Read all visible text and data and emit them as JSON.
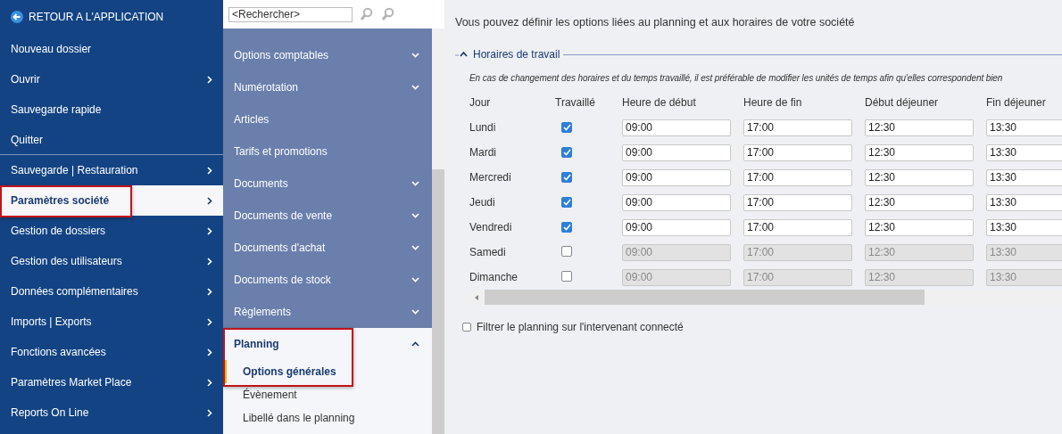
{
  "main_menu": {
    "back": "RETOUR A L'APPLICATION",
    "items": [
      {
        "label": "Nouveau dossier",
        "submenu": false,
        "selected": false,
        "highlighted": false,
        "divider_after": false
      },
      {
        "label": "Ouvrir",
        "submenu": true,
        "selected": false,
        "highlighted": false,
        "divider_after": false
      },
      {
        "label": "Sauvegarde rapide",
        "submenu": false,
        "selected": false,
        "highlighted": false,
        "divider_after": false
      },
      {
        "label": "Quitter",
        "submenu": false,
        "selected": false,
        "highlighted": false,
        "divider_after": true
      },
      {
        "label": "Sauvegarde | Restauration",
        "submenu": true,
        "selected": false,
        "highlighted": false,
        "divider_after": false
      },
      {
        "label": "Paramètres société",
        "submenu": true,
        "selected": true,
        "highlighted": true,
        "divider_after": false
      },
      {
        "label": "Gestion de dossiers",
        "submenu": true,
        "selected": false,
        "highlighted": false,
        "divider_after": false
      },
      {
        "label": "Gestion des utilisateurs",
        "submenu": true,
        "selected": false,
        "highlighted": false,
        "divider_after": false
      },
      {
        "label": "Données complémentaires",
        "submenu": true,
        "selected": false,
        "highlighted": false,
        "divider_after": false
      },
      {
        "label": "Imports | Exports",
        "submenu": true,
        "selected": false,
        "highlighted": false,
        "divider_after": false
      },
      {
        "label": "Fonctions avancées",
        "submenu": true,
        "selected": false,
        "highlighted": false,
        "divider_after": false
      },
      {
        "label": "Paramètres Market Place",
        "submenu": true,
        "selected": false,
        "highlighted": false,
        "divider_after": false
      },
      {
        "label": "Reports On Line",
        "submenu": true,
        "selected": false,
        "highlighted": false,
        "divider_after": false
      }
    ]
  },
  "settings_menu": {
    "search": {
      "placeholder": "<Rechercher>"
    },
    "items": [
      {
        "label": "Options comptables",
        "expanded": false,
        "expandable": true,
        "highlighted": false
      },
      {
        "label": "Numérotation",
        "expanded": false,
        "expandable": true,
        "highlighted": false
      },
      {
        "label": "Articles",
        "expanded": false,
        "expandable": false,
        "highlighted": false
      },
      {
        "label": "Tarifs et promotions",
        "expanded": false,
        "expandable": false,
        "highlighted": false
      },
      {
        "label": "Documents",
        "expanded": false,
        "expandable": true,
        "highlighted": false
      },
      {
        "label": "Documents de vente",
        "expanded": false,
        "expandable": true,
        "highlighted": false
      },
      {
        "label": "Documents d'achat",
        "expanded": false,
        "expandable": true,
        "highlighted": false
      },
      {
        "label": "Documents de stock",
        "expanded": false,
        "expandable": true,
        "highlighted": false
      },
      {
        "label": "Règlements",
        "expanded": false,
        "expandable": true,
        "highlighted": false
      },
      {
        "label": "Planning",
        "expanded": true,
        "expandable": true,
        "highlighted": true,
        "children": [
          {
            "label": "Options générales",
            "selected": true
          },
          {
            "label": "Évènement",
            "selected": false
          },
          {
            "label": "Libellé dans le planning",
            "selected": false
          }
        ]
      }
    ]
  },
  "content": {
    "intro": "Vous pouvez définir les options liées au planning et aux horaires de votre société",
    "section": {
      "title": "Horaires de travail",
      "expanded": true,
      "note": "En cas de changement des horaires et du temps travaillé, il est préférable de modifier les unités de temps afin qu'elles correspondent bien",
      "columns": [
        "Jour",
        "Travaillé",
        "Heure de début",
        "Heure de fin",
        "Début déjeuner",
        "Fin déjeuner"
      ],
      "rows": [
        {
          "day": "Lundi",
          "checked": true,
          "times": [
            "09:00",
            "17:00",
            "12:30",
            "13:30"
          ]
        },
        {
          "day": "Mardi",
          "checked": true,
          "times": [
            "09:00",
            "17:00",
            "12:30",
            "13:30"
          ]
        },
        {
          "day": "Mercredi",
          "checked": true,
          "times": [
            "09:00",
            "17:00",
            "12:30",
            "13:30"
          ]
        },
        {
          "day": "Jeudi",
          "checked": true,
          "times": [
            "09:00",
            "17:00",
            "12:30",
            "13:30"
          ]
        },
        {
          "day": "Vendredi",
          "checked": true,
          "times": [
            "09:00",
            "17:00",
            "12:30",
            "13:30"
          ]
        },
        {
          "day": "Samedi",
          "checked": false,
          "times": [
            "09:00",
            "17:00",
            "12:30",
            "13:30"
          ]
        },
        {
          "day": "Dimanche",
          "checked": false,
          "times": [
            "09:00",
            "17:00",
            "12:30",
            "13:30"
          ]
        }
      ]
    },
    "filter": {
      "label": "Filtrer le planning sur l'intervenant connecté",
      "checked": false
    }
  }
}
